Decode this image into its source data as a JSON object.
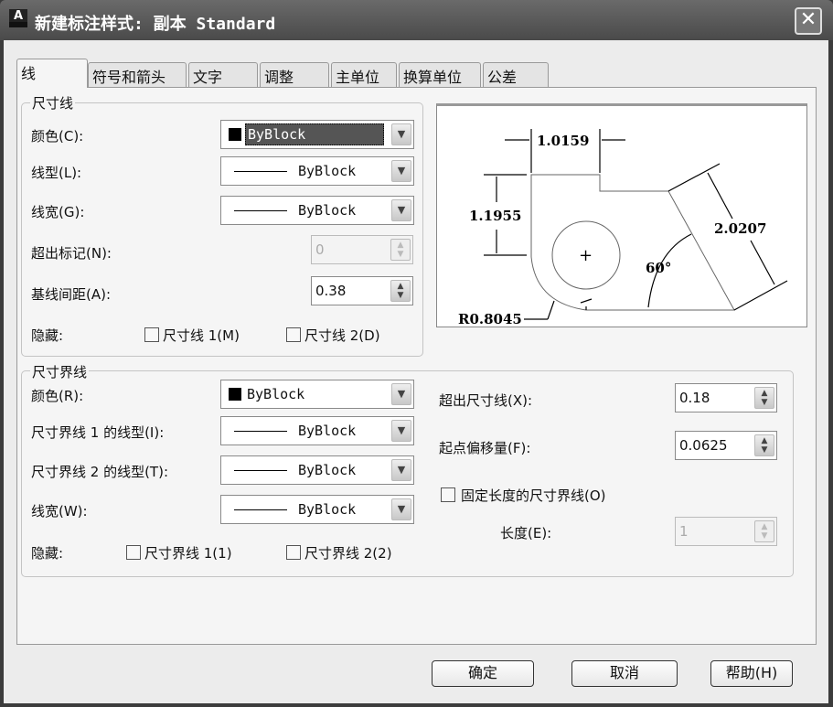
{
  "title": "新建标注样式: 副本 Standard",
  "tabs": [
    "线",
    "符号和箭头",
    "文字",
    "调整",
    "主单位",
    "换算单位",
    "公差"
  ],
  "dim_lines": {
    "legend": "尺寸线",
    "color_label": "颜色(C):",
    "color_value": "ByBlock",
    "linetype_label": "线型(L):",
    "linetype_value": "ByBlock",
    "lineweight_label": "线宽(G):",
    "lineweight_value": "ByBlock",
    "extend_ticks_label": "超出标记(N):",
    "extend_ticks_value": "0",
    "baseline_label": "基线间距(A):",
    "baseline_value": "0.38",
    "suppress_label": "隐藏:",
    "suppress1": "尺寸线 1(M)",
    "suppress2": "尺寸线 2(D)"
  },
  "ext_lines": {
    "legend": "尺寸界线",
    "color_label": "颜色(R):",
    "color_value": "ByBlock",
    "lt1_label": "尺寸界线 1 的线型(I):",
    "lt1_value": "ByBlock",
    "lt2_label": "尺寸界线 2 的线型(T):",
    "lt2_value": "ByBlock",
    "lw_label": "线宽(W):",
    "lw_value": "ByBlock",
    "suppress_label": "隐藏:",
    "suppress1": "尺寸界线 1(1)",
    "suppress2": "尺寸界线 2(2)",
    "extend_label": "超出尺寸线(X):",
    "extend_value": "0.18",
    "offset_label": "起点偏移量(F):",
    "offset_value": "0.0625",
    "fixed_label": "固定长度的尺寸界线(O)",
    "length_label": "长度(E):",
    "length_value": "1"
  },
  "preview": {
    "d1": "1.0159",
    "d2": "1.1955",
    "d3": "2.0207",
    "angle": "60°",
    "radius": "R0.8045"
  },
  "buttons": {
    "ok": "确定",
    "cancel": "取消",
    "help": "帮助(H)"
  }
}
